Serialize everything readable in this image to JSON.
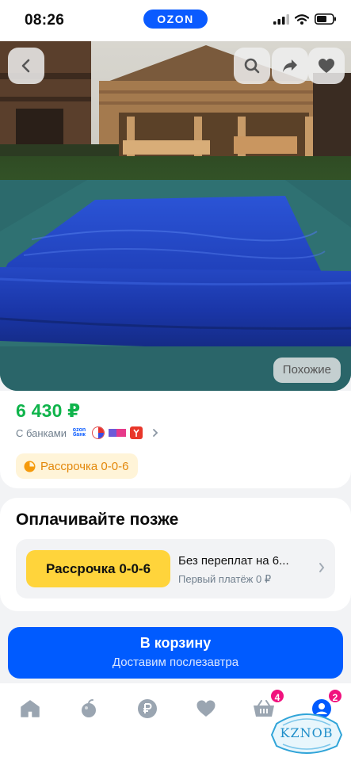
{
  "status_bar": {
    "time": "08:26",
    "brand_logo": "OZON",
    "icons": [
      "signal-icon",
      "wifi-icon",
      "battery-icon"
    ]
  },
  "hero": {
    "buttons": [
      "back-icon",
      "search-icon",
      "share-icon",
      "heart-icon"
    ],
    "similar_label": "Похожие"
  },
  "product": {
    "price": "6 430 ₽",
    "with_banks_label": "С банками",
    "bank_logo_line1": "ozon",
    "bank_logo_line2": "банк",
    "installment_badge": "Рассрочка 0-0-6"
  },
  "pay_later": {
    "title": "Оплачивайте позже",
    "button_label": "Рассрочка 0-0-6",
    "line1": "Без переплат на 6...",
    "line2": "Первый платёж 0 ₽"
  },
  "cart": {
    "title": "В корзину",
    "subtitle": "Доставим послезавтра"
  },
  "bottom_nav": {
    "items": [
      "home-icon",
      "fresh-icon",
      "ruble-icon",
      "favorites-icon",
      "cart-icon",
      "profile-icon"
    ],
    "cart_badge": "4",
    "profile_badge": "2"
  },
  "watermark": {
    "text": "KZNOB"
  },
  "colors": {
    "brand": "#005bff",
    "price": "#0fb44b",
    "installment": "#ffd43b",
    "badge": "#f1117e"
  }
}
